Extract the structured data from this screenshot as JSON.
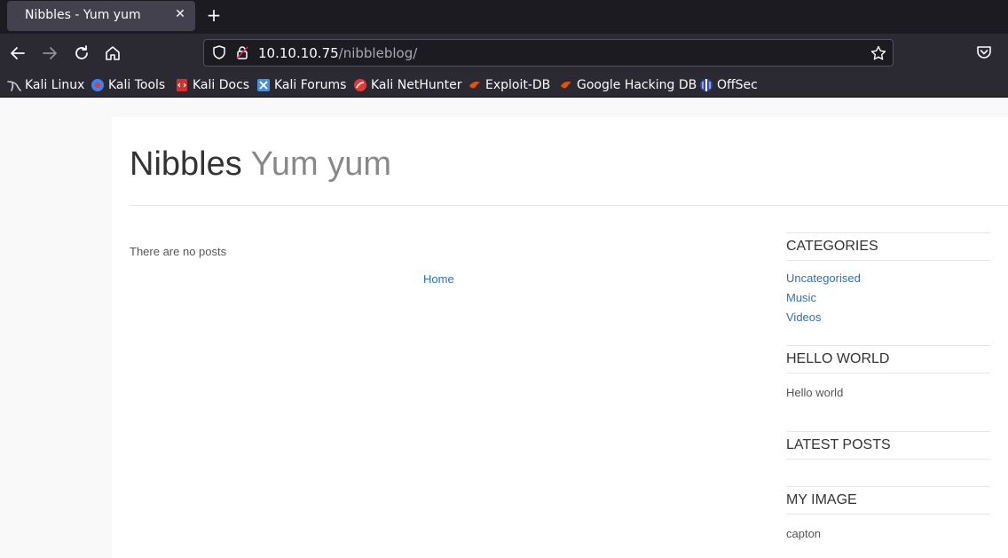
{
  "browser": {
    "tab_title": "Nibbles - Yum yum",
    "tab_close": "✕",
    "new_tab": "+",
    "url_host": "10.10.10.75",
    "url_path": "/nibbleblog/",
    "bookmarks": [
      {
        "label": "Kali Linux",
        "icon": "kali-dragon-icon",
        "color": "#cfcfd8"
      },
      {
        "label": "Kali Tools",
        "icon": "kali-tools-icon",
        "color": "#3b82f6"
      },
      {
        "label": "Kali Docs",
        "icon": "kali-docs-icon",
        "color": "#d32f2f"
      },
      {
        "label": "Kali Forums",
        "icon": "kali-forums-icon",
        "color": "#4a90d9"
      },
      {
        "label": "Kali NetHunter",
        "icon": "nethunter-icon",
        "color": "#e53935"
      },
      {
        "label": "Exploit-DB",
        "icon": "exploit-db-icon",
        "color": "#e65100"
      },
      {
        "label": "Google Hacking DB",
        "icon": "ghdb-icon",
        "color": "#e65100"
      },
      {
        "label": "OffSec",
        "icon": "offsec-icon",
        "color": "#5b6ee1"
      }
    ]
  },
  "site": {
    "name": "Nibbles",
    "slogan": "Yum yum",
    "no_posts": "There are no posts",
    "home_link": "Home",
    "accent": "#2a72b5"
  },
  "sidebar": {
    "categories": {
      "title": "CATEGORIES",
      "items": [
        "Uncategorised",
        "Music",
        "Videos"
      ]
    },
    "hello_world": {
      "title": "HELLO WORLD",
      "text": "Hello world"
    },
    "latest_posts": {
      "title": "LATEST POSTS"
    },
    "my_image": {
      "title": "MY IMAGE",
      "text": "capton"
    }
  }
}
